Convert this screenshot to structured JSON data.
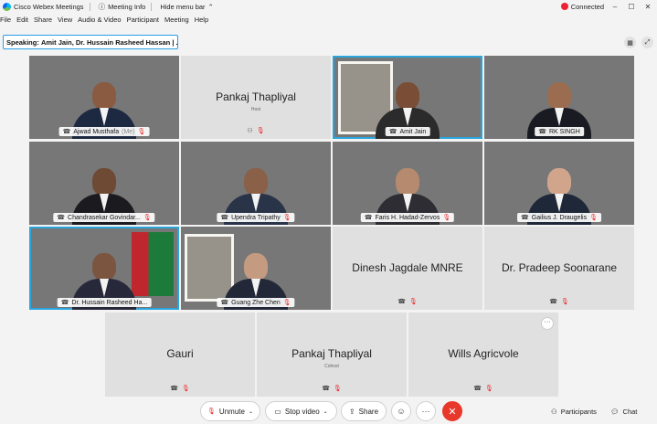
{
  "titlebar": {
    "app_name": "Cisco Webex Meetings",
    "meeting_info": "Meeting Info",
    "hide_menu": "Hide menu bar",
    "status": "Connected",
    "status_color": "#e22b2b"
  },
  "menu": [
    "File",
    "Edit",
    "Share",
    "View",
    "Audio & Video",
    "Participant",
    "Meeting",
    "Help"
  ],
  "speaking": {
    "label": "Speaking:",
    "names": "Amit Jain, Dr. Hussain Rasheed Hassan | ..."
  },
  "tiles": [
    {
      "name": "Ajwad Musthafa",
      "suffix": "(Me)",
      "video": true,
      "muted": true
    },
    {
      "name": "Pankaj Thapliyal",
      "role": "Host",
      "video": false,
      "muted": true
    },
    {
      "name": "Amit Jain",
      "video": true,
      "muted": false,
      "active": true
    },
    {
      "name": "RK SINGH",
      "video": true,
      "muted": false
    },
    {
      "name": "Chandrasekar Govindar...",
      "video": true,
      "muted": true
    },
    {
      "name": "Upendra Tripathy",
      "video": true,
      "muted": true
    },
    {
      "name": "Faris H. Hadad-Zervos",
      "video": true,
      "muted": true
    },
    {
      "name": "Gailius J. Draugelis",
      "video": true,
      "muted": true
    },
    {
      "name": "Dr. Hussain Rasheed Ha...",
      "video": true,
      "muted": false,
      "active": true
    },
    {
      "name": "Guang Zhe Chen",
      "video": true,
      "muted": true
    },
    {
      "name": "Dinesh Jagdale MNRE",
      "video": false,
      "muted": true
    },
    {
      "name": "Dr. Pradeep Soonarane",
      "video": false,
      "muted": true
    },
    {
      "name": "Gauri",
      "video": false,
      "muted": true
    },
    {
      "name": "Pankaj Thapliyal",
      "role": "Cohost",
      "video": false,
      "muted": true
    },
    {
      "name": "Wills Agricvole",
      "video": false,
      "muted": true
    }
  ],
  "controls": {
    "unmute": "Unmute",
    "stop_video": "Stop video",
    "share": "Share",
    "participants": "Participants",
    "chat": "Chat",
    "leave_color": "#e8382c"
  }
}
